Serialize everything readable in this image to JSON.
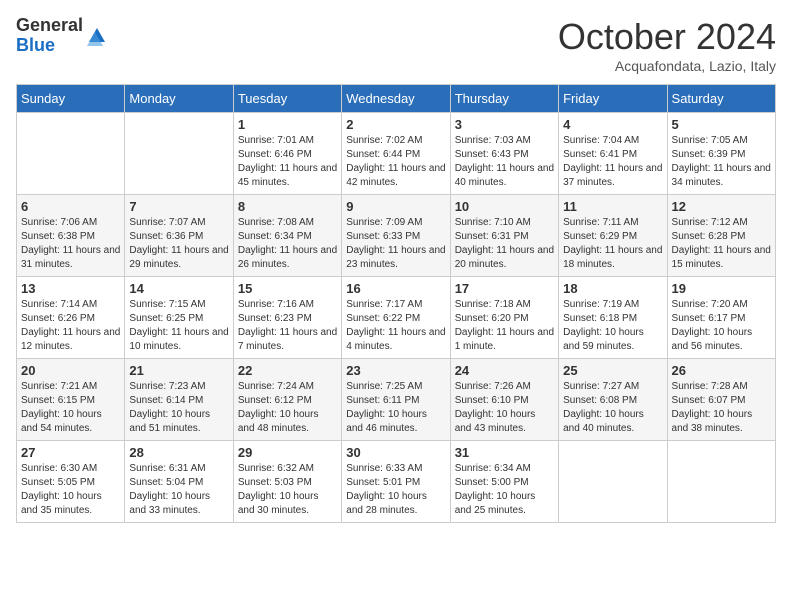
{
  "header": {
    "logo_line1": "General",
    "logo_line2": "Blue",
    "month_title": "October 2024",
    "location": "Acquafondata, Lazio, Italy"
  },
  "weekdays": [
    "Sunday",
    "Monday",
    "Tuesday",
    "Wednesday",
    "Thursday",
    "Friday",
    "Saturday"
  ],
  "weeks": [
    [
      {
        "day": "",
        "info": ""
      },
      {
        "day": "",
        "info": ""
      },
      {
        "day": "1",
        "info": "Sunrise: 7:01 AM\nSunset: 6:46 PM\nDaylight: 11 hours and 45 minutes."
      },
      {
        "day": "2",
        "info": "Sunrise: 7:02 AM\nSunset: 6:44 PM\nDaylight: 11 hours and 42 minutes."
      },
      {
        "day": "3",
        "info": "Sunrise: 7:03 AM\nSunset: 6:43 PM\nDaylight: 11 hours and 40 minutes."
      },
      {
        "day": "4",
        "info": "Sunrise: 7:04 AM\nSunset: 6:41 PM\nDaylight: 11 hours and 37 minutes."
      },
      {
        "day": "5",
        "info": "Sunrise: 7:05 AM\nSunset: 6:39 PM\nDaylight: 11 hours and 34 minutes."
      }
    ],
    [
      {
        "day": "6",
        "info": "Sunrise: 7:06 AM\nSunset: 6:38 PM\nDaylight: 11 hours and 31 minutes."
      },
      {
        "day": "7",
        "info": "Sunrise: 7:07 AM\nSunset: 6:36 PM\nDaylight: 11 hours and 29 minutes."
      },
      {
        "day": "8",
        "info": "Sunrise: 7:08 AM\nSunset: 6:34 PM\nDaylight: 11 hours and 26 minutes."
      },
      {
        "day": "9",
        "info": "Sunrise: 7:09 AM\nSunset: 6:33 PM\nDaylight: 11 hours and 23 minutes."
      },
      {
        "day": "10",
        "info": "Sunrise: 7:10 AM\nSunset: 6:31 PM\nDaylight: 11 hours and 20 minutes."
      },
      {
        "day": "11",
        "info": "Sunrise: 7:11 AM\nSunset: 6:29 PM\nDaylight: 11 hours and 18 minutes."
      },
      {
        "day": "12",
        "info": "Sunrise: 7:12 AM\nSunset: 6:28 PM\nDaylight: 11 hours and 15 minutes."
      }
    ],
    [
      {
        "day": "13",
        "info": "Sunrise: 7:14 AM\nSunset: 6:26 PM\nDaylight: 11 hours and 12 minutes."
      },
      {
        "day": "14",
        "info": "Sunrise: 7:15 AM\nSunset: 6:25 PM\nDaylight: 11 hours and 10 minutes."
      },
      {
        "day": "15",
        "info": "Sunrise: 7:16 AM\nSunset: 6:23 PM\nDaylight: 11 hours and 7 minutes."
      },
      {
        "day": "16",
        "info": "Sunrise: 7:17 AM\nSunset: 6:22 PM\nDaylight: 11 hours and 4 minutes."
      },
      {
        "day": "17",
        "info": "Sunrise: 7:18 AM\nSunset: 6:20 PM\nDaylight: 11 hours and 1 minute."
      },
      {
        "day": "18",
        "info": "Sunrise: 7:19 AM\nSunset: 6:18 PM\nDaylight: 10 hours and 59 minutes."
      },
      {
        "day": "19",
        "info": "Sunrise: 7:20 AM\nSunset: 6:17 PM\nDaylight: 10 hours and 56 minutes."
      }
    ],
    [
      {
        "day": "20",
        "info": "Sunrise: 7:21 AM\nSunset: 6:15 PM\nDaylight: 10 hours and 54 minutes."
      },
      {
        "day": "21",
        "info": "Sunrise: 7:23 AM\nSunset: 6:14 PM\nDaylight: 10 hours and 51 minutes."
      },
      {
        "day": "22",
        "info": "Sunrise: 7:24 AM\nSunset: 6:12 PM\nDaylight: 10 hours and 48 minutes."
      },
      {
        "day": "23",
        "info": "Sunrise: 7:25 AM\nSunset: 6:11 PM\nDaylight: 10 hours and 46 minutes."
      },
      {
        "day": "24",
        "info": "Sunrise: 7:26 AM\nSunset: 6:10 PM\nDaylight: 10 hours and 43 minutes."
      },
      {
        "day": "25",
        "info": "Sunrise: 7:27 AM\nSunset: 6:08 PM\nDaylight: 10 hours and 40 minutes."
      },
      {
        "day": "26",
        "info": "Sunrise: 7:28 AM\nSunset: 6:07 PM\nDaylight: 10 hours and 38 minutes."
      }
    ],
    [
      {
        "day": "27",
        "info": "Sunrise: 6:30 AM\nSunset: 5:05 PM\nDaylight: 10 hours and 35 minutes."
      },
      {
        "day": "28",
        "info": "Sunrise: 6:31 AM\nSunset: 5:04 PM\nDaylight: 10 hours and 33 minutes."
      },
      {
        "day": "29",
        "info": "Sunrise: 6:32 AM\nSunset: 5:03 PM\nDaylight: 10 hours and 30 minutes."
      },
      {
        "day": "30",
        "info": "Sunrise: 6:33 AM\nSunset: 5:01 PM\nDaylight: 10 hours and 28 minutes."
      },
      {
        "day": "31",
        "info": "Sunrise: 6:34 AM\nSunset: 5:00 PM\nDaylight: 10 hours and 25 minutes."
      },
      {
        "day": "",
        "info": ""
      },
      {
        "day": "",
        "info": ""
      }
    ]
  ]
}
